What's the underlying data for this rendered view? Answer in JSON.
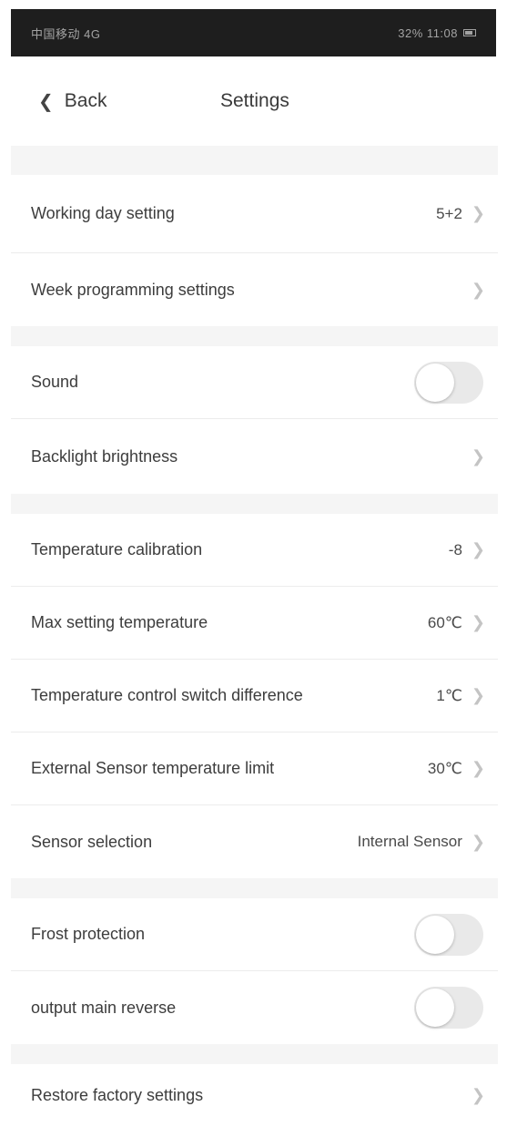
{
  "status_bar": {
    "left": "中国移动 4G",
    "right": "32% 11:08"
  },
  "nav": {
    "back_label": "Back",
    "title": "Settings"
  },
  "rows": {
    "working_day": {
      "label": "Working day setting",
      "value": "5+2"
    },
    "week_programming": {
      "label": "Week programming settings"
    },
    "sound": {
      "label": "Sound",
      "toggle_on": false
    },
    "backlight": {
      "label": "Backlight brightness"
    },
    "temp_calibration": {
      "label": "Temperature calibration",
      "value": "-8"
    },
    "max_temp": {
      "label": "Max setting temperature",
      "value": "60℃"
    },
    "switch_diff": {
      "label": "Temperature control switch difference",
      "value": "1℃"
    },
    "ext_sensor_limit": {
      "label": "External Sensor temperature limit",
      "value": "30℃"
    },
    "sensor_selection": {
      "label": "Sensor selection",
      "value": "Internal Sensor"
    },
    "frost_protection": {
      "label": "Frost protection",
      "toggle_on": false
    },
    "output_reverse": {
      "label": "output main reverse",
      "toggle_on": false
    },
    "factory_reset": {
      "label": "Restore factory settings"
    }
  },
  "icons": {
    "back": "back-arrow-icon",
    "chevron": "chevron-right-icon",
    "battery": "battery-icon"
  },
  "colors": {
    "separator": "#f5f5f5",
    "toggle_off": "#e9e9e9",
    "chevron": "#c4c4c4"
  }
}
